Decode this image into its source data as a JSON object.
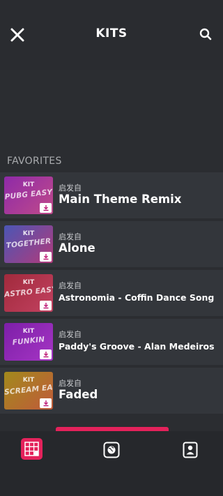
{
  "header": {
    "title": "KITS"
  },
  "favorites": {
    "section_label": "FAVORITES",
    "items": [
      {
        "kit_label": "KIT",
        "kit_name": "PUBG EASY",
        "source_label": "启发自",
        "song_title": "Main Theme Remix",
        "thumb_colors": [
          "#8e2aa8",
          "#c04a8a"
        ]
      },
      {
        "kit_label": "KIT",
        "kit_name": "TOGETHER",
        "source_label": "启发自",
        "song_title": "Alone",
        "thumb_colors": [
          "#4b56b5",
          "#b23a7a"
        ]
      },
      {
        "kit_label": "KIT",
        "kit_name": "ASTRO EASY",
        "source_label": "启发自",
        "song_title": "Astronomia - Coffin Dance Song",
        "thumb_colors": [
          "#a12a3c",
          "#c24160"
        ]
      },
      {
        "kit_label": "KIT",
        "kit_name": "FUNKIN",
        "source_label": "启发自",
        "song_title": "Paddy's Groove - Alan Medeiros",
        "thumb_colors": [
          "#7d1fa8",
          "#a535c4"
        ]
      },
      {
        "kit_label": "KIT",
        "kit_name": "SCREAM EASY",
        "source_label": "启发自",
        "song_title": "Faded",
        "thumb_colors": [
          "#a28a1c",
          "#c05a3a"
        ]
      }
    ]
  },
  "colors": {
    "accent": "#e4225b",
    "background": "#2b2d31",
    "row": "#33363b"
  }
}
